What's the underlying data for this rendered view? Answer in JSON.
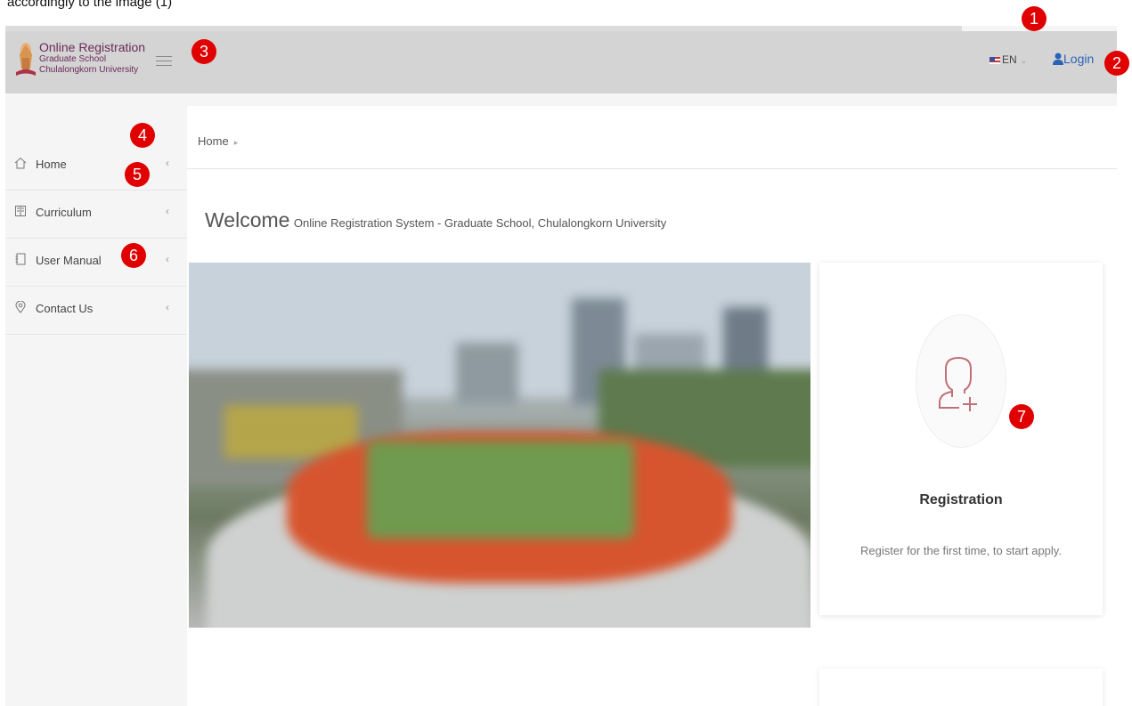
{
  "caption": "accordingly to the image (1)",
  "header": {
    "logo_title": "Online Registration",
    "logo_sub1": "Graduate School",
    "logo_sub2": "Chulalongkorn University",
    "lang_label": "EN",
    "login_label": "Login"
  },
  "sidebar": {
    "items": [
      {
        "label": "Home",
        "icon": "home-icon"
      },
      {
        "label": "Curriculum",
        "icon": "book-icon"
      },
      {
        "label": "User Manual",
        "icon": "notebook-icon"
      },
      {
        "label": "Contact Us",
        "icon": "map-pin-icon"
      }
    ]
  },
  "breadcrumb": {
    "home": "Home"
  },
  "welcome": {
    "big": "Welcome",
    "small": "Online Registration System - Graduate School, Chulalongkorn University"
  },
  "registration_card": {
    "title": "Registration",
    "description": "Register for the first time, to start apply."
  },
  "badges": [
    "1",
    "2",
    "3",
    "4",
    "5",
    "6",
    "7"
  ],
  "colors": {
    "header_bg": "#d4d4d4",
    "logo_purple": "#6b2a5a",
    "login_blue": "#2a62b8",
    "badge_red": "#e00000",
    "icon_pink": "#c0707a"
  }
}
